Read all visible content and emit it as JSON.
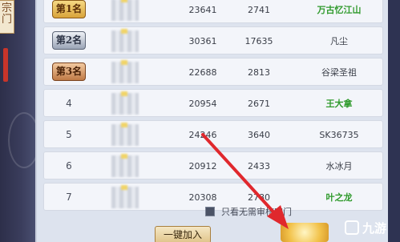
{
  "left_tag": "宗门",
  "rows": [
    {
      "rank": "第1名",
      "rank_kind": "gold",
      "power": "23641",
      "contrib": "2741",
      "name": "万古忆江山",
      "name_color": "green"
    },
    {
      "rank": "第2名",
      "rank_kind": "silver",
      "power": "30361",
      "contrib": "17635",
      "name": "凡尘",
      "name_color": "dark"
    },
    {
      "rank": "第3名",
      "rank_kind": "bronze",
      "power": "22688",
      "contrib": "2813",
      "name": "谷梁圣祖",
      "name_color": "dark"
    },
    {
      "rank": "4",
      "rank_kind": "plain",
      "power": "20954",
      "contrib": "2671",
      "name": "王大拿",
      "name_color": "green"
    },
    {
      "rank": "5",
      "rank_kind": "plain",
      "power": "24246",
      "contrib": "3640",
      "name": "SK36735",
      "name_color": "dark"
    },
    {
      "rank": "6",
      "rank_kind": "plain",
      "power": "20912",
      "contrib": "2433",
      "name": "水冰月",
      "name_color": "dark"
    },
    {
      "rank": "7",
      "rank_kind": "plain",
      "power": "20308",
      "contrib": "2780",
      "name": "叶之龙",
      "name_color": "green"
    }
  ],
  "bottom": {
    "checkbox_label": "只看无需审核宗门",
    "join_button": "一键加入"
  },
  "watermark": {
    "text": "九游"
  },
  "colors": {
    "green_name": "#2f9a2c",
    "arrow": "#e0282d"
  }
}
